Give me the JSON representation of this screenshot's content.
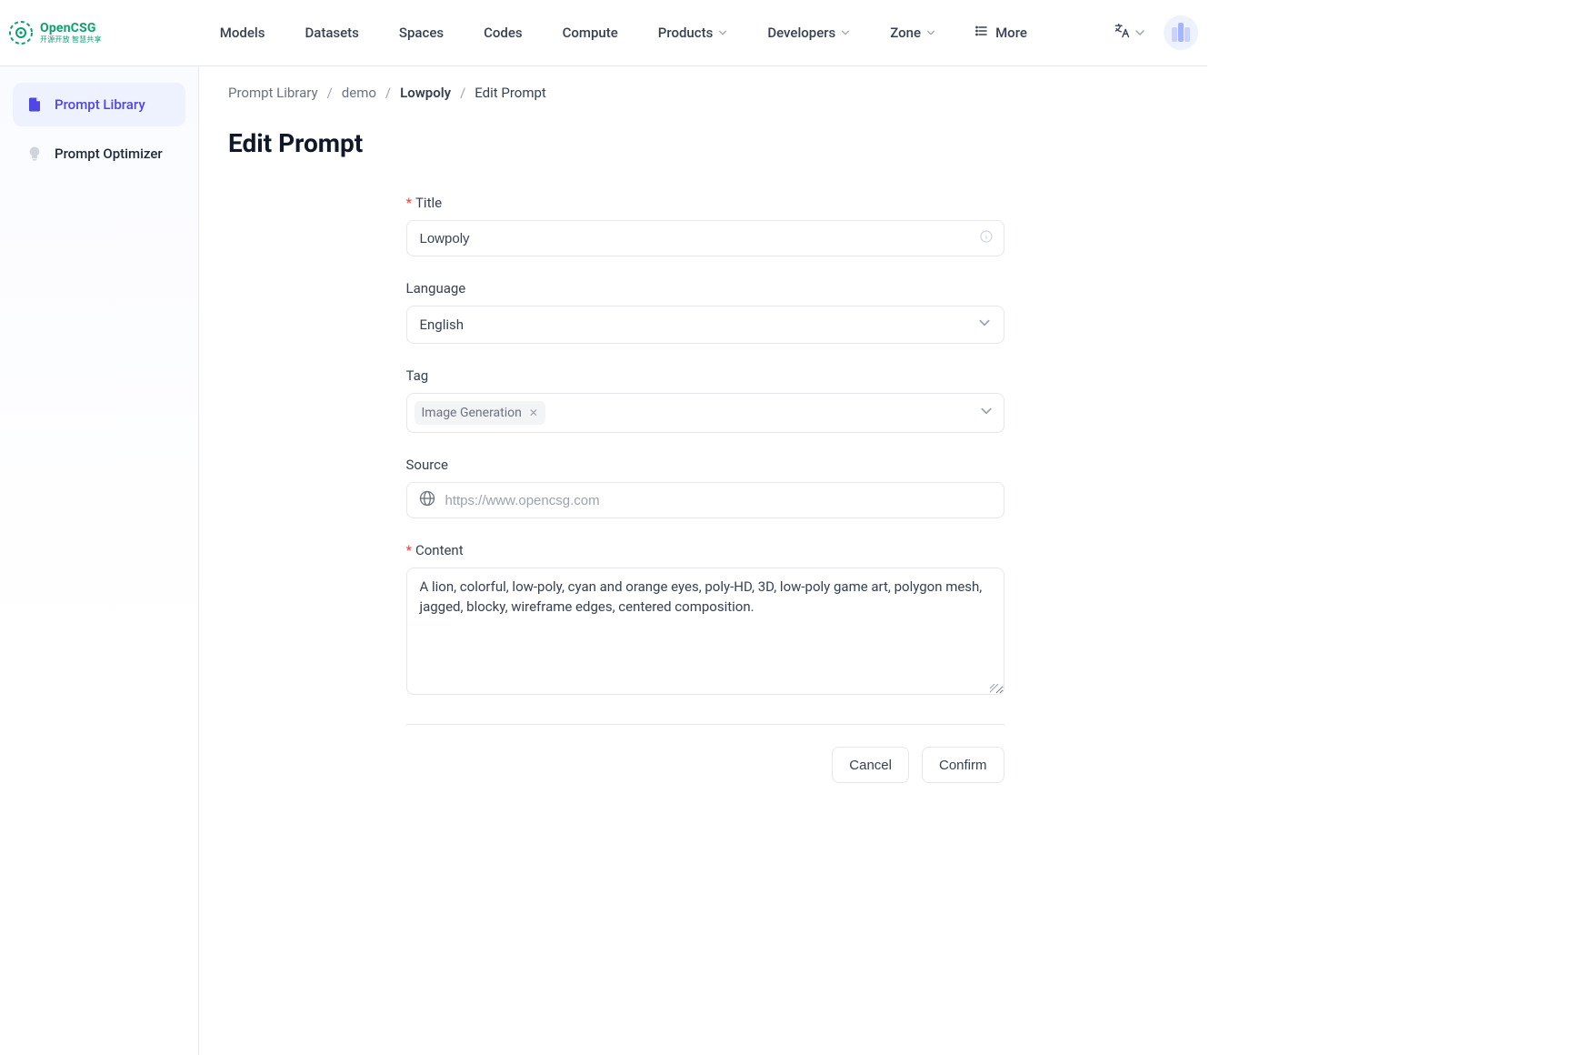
{
  "brand": {
    "name": "OpenCSG",
    "tagline": "开源开放 智慧共享"
  },
  "nav": {
    "items": [
      {
        "label": "Models",
        "dropdown": false
      },
      {
        "label": "Datasets",
        "dropdown": false
      },
      {
        "label": "Spaces",
        "dropdown": false
      },
      {
        "label": "Codes",
        "dropdown": false
      },
      {
        "label": "Compute",
        "dropdown": false
      },
      {
        "label": "Products",
        "dropdown": true
      },
      {
        "label": "Developers",
        "dropdown": true
      },
      {
        "label": "Zone",
        "dropdown": true
      }
    ],
    "more_label": "More"
  },
  "sidebar": {
    "items": [
      {
        "id": "prompt-library",
        "label": "Prompt Library",
        "active": true,
        "icon": "file-icon"
      },
      {
        "id": "prompt-optimizer",
        "label": "Prompt Optimizer",
        "active": false,
        "icon": "bulb-icon"
      }
    ]
  },
  "breadcrumb": {
    "items": [
      {
        "label": "Prompt Library",
        "kind": "link"
      },
      {
        "label": "demo",
        "kind": "link"
      },
      {
        "label": "Lowpoly",
        "kind": "strong"
      },
      {
        "label": "Edit Prompt",
        "kind": "current"
      }
    ],
    "separator": "/"
  },
  "page": {
    "title": "Edit Prompt"
  },
  "form": {
    "title": {
      "label": "Title",
      "required": true,
      "value": "Lowpoly"
    },
    "language": {
      "label": "Language",
      "value": "English"
    },
    "tag": {
      "label": "Tag",
      "tags": [
        "Image Generation"
      ]
    },
    "source": {
      "label": "Source",
      "placeholder": "https://www.opencsg.com",
      "value": ""
    },
    "content": {
      "label": "Content",
      "required": true,
      "value": "A lion, colorful, low-poly, cyan and orange eyes, poly-HD, 3D, low-poly game art, polygon mesh, jagged, blocky, wireframe edges, centered composition."
    },
    "actions": {
      "cancel": "Cancel",
      "confirm": "Confirm"
    }
  }
}
